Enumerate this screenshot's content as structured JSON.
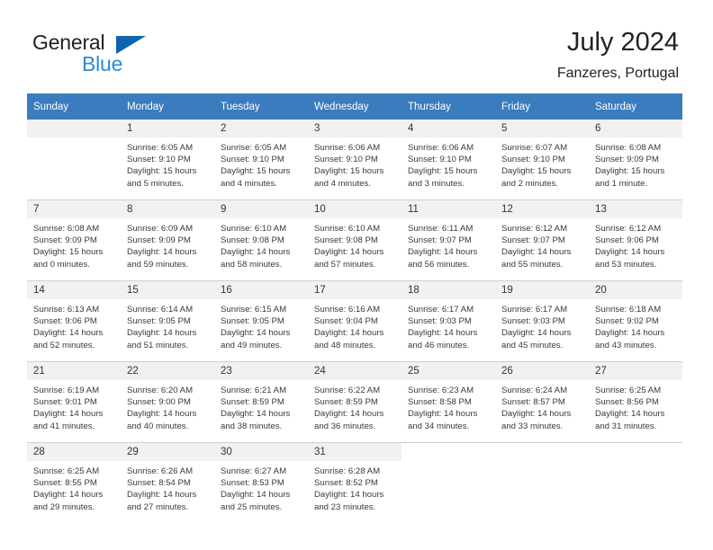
{
  "brand": {
    "name_dark": "General",
    "name_light": "Blue",
    "triangle_color": "#0f64ad",
    "light_color": "#2e8bd4"
  },
  "header": {
    "title": "July 2024",
    "location": "Fanzeres, Portugal",
    "header_bg": "#3a7cbe",
    "daynum_bg": "#f1f1f1"
  },
  "weekdays": [
    "Sunday",
    "Monday",
    "Tuesday",
    "Wednesday",
    "Thursday",
    "Friday",
    "Saturday"
  ],
  "weeks": [
    [
      {
        "day": "",
        "empty": true,
        "lines": []
      },
      {
        "day": "1",
        "lines": [
          "Sunrise: 6:05 AM",
          "Sunset: 9:10 PM",
          "Daylight: 15 hours",
          "and 5 minutes."
        ]
      },
      {
        "day": "2",
        "lines": [
          "Sunrise: 6:05 AM",
          "Sunset: 9:10 PM",
          "Daylight: 15 hours",
          "and 4 minutes."
        ]
      },
      {
        "day": "3",
        "lines": [
          "Sunrise: 6:06 AM",
          "Sunset: 9:10 PM",
          "Daylight: 15 hours",
          "and 4 minutes."
        ]
      },
      {
        "day": "4",
        "lines": [
          "Sunrise: 6:06 AM",
          "Sunset: 9:10 PM",
          "Daylight: 15 hours",
          "and 3 minutes."
        ]
      },
      {
        "day": "5",
        "lines": [
          "Sunrise: 6:07 AM",
          "Sunset: 9:10 PM",
          "Daylight: 15 hours",
          "and 2 minutes."
        ]
      },
      {
        "day": "6",
        "lines": [
          "Sunrise: 6:08 AM",
          "Sunset: 9:09 PM",
          "Daylight: 15 hours",
          "and 1 minute."
        ]
      }
    ],
    [
      {
        "day": "7",
        "lines": [
          "Sunrise: 6:08 AM",
          "Sunset: 9:09 PM",
          "Daylight: 15 hours",
          "and 0 minutes."
        ]
      },
      {
        "day": "8",
        "lines": [
          "Sunrise: 6:09 AM",
          "Sunset: 9:09 PM",
          "Daylight: 14 hours",
          "and 59 minutes."
        ]
      },
      {
        "day": "9",
        "lines": [
          "Sunrise: 6:10 AM",
          "Sunset: 9:08 PM",
          "Daylight: 14 hours",
          "and 58 minutes."
        ]
      },
      {
        "day": "10",
        "lines": [
          "Sunrise: 6:10 AM",
          "Sunset: 9:08 PM",
          "Daylight: 14 hours",
          "and 57 minutes."
        ]
      },
      {
        "day": "11",
        "lines": [
          "Sunrise: 6:11 AM",
          "Sunset: 9:07 PM",
          "Daylight: 14 hours",
          "and 56 minutes."
        ]
      },
      {
        "day": "12",
        "lines": [
          "Sunrise: 6:12 AM",
          "Sunset: 9:07 PM",
          "Daylight: 14 hours",
          "and 55 minutes."
        ]
      },
      {
        "day": "13",
        "lines": [
          "Sunrise: 6:12 AM",
          "Sunset: 9:06 PM",
          "Daylight: 14 hours",
          "and 53 minutes."
        ]
      }
    ],
    [
      {
        "day": "14",
        "lines": [
          "Sunrise: 6:13 AM",
          "Sunset: 9:06 PM",
          "Daylight: 14 hours",
          "and 52 minutes."
        ]
      },
      {
        "day": "15",
        "lines": [
          "Sunrise: 6:14 AM",
          "Sunset: 9:05 PM",
          "Daylight: 14 hours",
          "and 51 minutes."
        ]
      },
      {
        "day": "16",
        "lines": [
          "Sunrise: 6:15 AM",
          "Sunset: 9:05 PM",
          "Daylight: 14 hours",
          "and 49 minutes."
        ]
      },
      {
        "day": "17",
        "lines": [
          "Sunrise: 6:16 AM",
          "Sunset: 9:04 PM",
          "Daylight: 14 hours",
          "and 48 minutes."
        ]
      },
      {
        "day": "18",
        "lines": [
          "Sunrise: 6:17 AM",
          "Sunset: 9:03 PM",
          "Daylight: 14 hours",
          "and 46 minutes."
        ]
      },
      {
        "day": "19",
        "lines": [
          "Sunrise: 6:17 AM",
          "Sunset: 9:03 PM",
          "Daylight: 14 hours",
          "and 45 minutes."
        ]
      },
      {
        "day": "20",
        "lines": [
          "Sunrise: 6:18 AM",
          "Sunset: 9:02 PM",
          "Daylight: 14 hours",
          "and 43 minutes."
        ]
      }
    ],
    [
      {
        "day": "21",
        "lines": [
          "Sunrise: 6:19 AM",
          "Sunset: 9:01 PM",
          "Daylight: 14 hours",
          "and 41 minutes."
        ]
      },
      {
        "day": "22",
        "lines": [
          "Sunrise: 6:20 AM",
          "Sunset: 9:00 PM",
          "Daylight: 14 hours",
          "and 40 minutes."
        ]
      },
      {
        "day": "23",
        "lines": [
          "Sunrise: 6:21 AM",
          "Sunset: 8:59 PM",
          "Daylight: 14 hours",
          "and 38 minutes."
        ]
      },
      {
        "day": "24",
        "lines": [
          "Sunrise: 6:22 AM",
          "Sunset: 8:59 PM",
          "Daylight: 14 hours",
          "and 36 minutes."
        ]
      },
      {
        "day": "25",
        "lines": [
          "Sunrise: 6:23 AM",
          "Sunset: 8:58 PM",
          "Daylight: 14 hours",
          "and 34 minutes."
        ]
      },
      {
        "day": "26",
        "lines": [
          "Sunrise: 6:24 AM",
          "Sunset: 8:57 PM",
          "Daylight: 14 hours",
          "and 33 minutes."
        ]
      },
      {
        "day": "27",
        "lines": [
          "Sunrise: 6:25 AM",
          "Sunset: 8:56 PM",
          "Daylight: 14 hours",
          "and 31 minutes."
        ]
      }
    ],
    [
      {
        "day": "28",
        "lines": [
          "Sunrise: 6:25 AM",
          "Sunset: 8:55 PM",
          "Daylight: 14 hours",
          "and 29 minutes."
        ]
      },
      {
        "day": "29",
        "lines": [
          "Sunrise: 6:26 AM",
          "Sunset: 8:54 PM",
          "Daylight: 14 hours",
          "and 27 minutes."
        ]
      },
      {
        "day": "30",
        "lines": [
          "Sunrise: 6:27 AM",
          "Sunset: 8:53 PM",
          "Daylight: 14 hours",
          "and 25 minutes."
        ]
      },
      {
        "day": "31",
        "lines": [
          "Sunrise: 6:28 AM",
          "Sunset: 8:52 PM",
          "Daylight: 14 hours",
          "and 23 minutes."
        ]
      },
      {
        "day": "",
        "blank": true,
        "lines": []
      },
      {
        "day": "",
        "blank": true,
        "lines": []
      },
      {
        "day": "",
        "blank": true,
        "lines": []
      }
    ]
  ]
}
